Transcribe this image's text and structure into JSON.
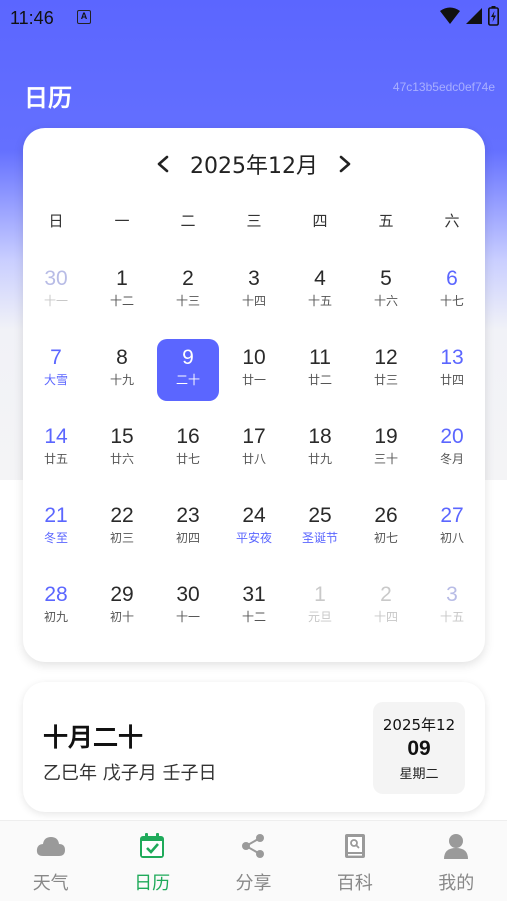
{
  "status_bar": {
    "time": "11:46",
    "notification_glyph": "A"
  },
  "header": {
    "title": "日历",
    "hash": "47c13b5edc0ef74e"
  },
  "calendar": {
    "month_title": "2025年12月",
    "prev_glyph": "‹",
    "next_glyph": "›",
    "weekdays": [
      "日",
      "一",
      "二",
      "三",
      "四",
      "五",
      "六"
    ],
    "weeks": [
      [
        {
          "num": "30",
          "lunar": "十一",
          "other": true
        },
        {
          "num": "1",
          "lunar": "十二"
        },
        {
          "num": "2",
          "lunar": "十三"
        },
        {
          "num": "3",
          "lunar": "十四"
        },
        {
          "num": "4",
          "lunar": "十五"
        },
        {
          "num": "5",
          "lunar": "十六"
        },
        {
          "num": "6",
          "lunar": "十七",
          "weekend": true
        }
      ],
      [
        {
          "num": "7",
          "lunar": "大雪",
          "weekend": true,
          "festival": true
        },
        {
          "num": "8",
          "lunar": "十九"
        },
        {
          "num": "9",
          "lunar": "二十",
          "selected": true
        },
        {
          "num": "10",
          "lunar": "廿一"
        },
        {
          "num": "11",
          "lunar": "廿二"
        },
        {
          "num": "12",
          "lunar": "廿三"
        },
        {
          "num": "13",
          "lunar": "廿四",
          "weekend": true
        }
      ],
      [
        {
          "num": "14",
          "lunar": "廿五",
          "weekend": true
        },
        {
          "num": "15",
          "lunar": "廿六"
        },
        {
          "num": "16",
          "lunar": "廿七"
        },
        {
          "num": "17",
          "lunar": "廿八"
        },
        {
          "num": "18",
          "lunar": "廿九"
        },
        {
          "num": "19",
          "lunar": "三十"
        },
        {
          "num": "20",
          "lunar": "冬月",
          "weekend": true
        }
      ],
      [
        {
          "num": "21",
          "lunar": "冬至",
          "weekend": true,
          "festival": true
        },
        {
          "num": "22",
          "lunar": "初三"
        },
        {
          "num": "23",
          "lunar": "初四"
        },
        {
          "num": "24",
          "lunar": "平安夜",
          "festival": true
        },
        {
          "num": "25",
          "lunar": "圣诞节",
          "festival": true
        },
        {
          "num": "26",
          "lunar": "初七"
        },
        {
          "num": "27",
          "lunar": "初八",
          "weekend": true
        }
      ],
      [
        {
          "num": "28",
          "lunar": "初九",
          "weekend": true
        },
        {
          "num": "29",
          "lunar": "初十"
        },
        {
          "num": "30",
          "lunar": "十一"
        },
        {
          "num": "31",
          "lunar": "十二"
        },
        {
          "num": "1",
          "lunar": "元旦",
          "other": true,
          "gray": true,
          "festival": true
        },
        {
          "num": "2",
          "lunar": "十四",
          "other": true,
          "gray": true
        },
        {
          "num": "3",
          "lunar": "十五",
          "other": true
        }
      ]
    ]
  },
  "info": {
    "lunar_date": "十月二十",
    "ganzhi": "乙巳年 戊子月 壬子日",
    "year_month": "2025年12",
    "day": "09",
    "weekday": "星期二"
  },
  "bottom_nav": {
    "items": [
      {
        "label": "天气",
        "icon": "cloud-icon"
      },
      {
        "label": "日历",
        "icon": "calendar-check-icon",
        "active": true
      },
      {
        "label": "分享",
        "icon": "share-icon"
      },
      {
        "label": "百科",
        "icon": "encyclopedia-icon"
      },
      {
        "label": "我的",
        "icon": "profile-icon"
      }
    ]
  },
  "colors": {
    "accent": "#5b66ff",
    "active_nav": "#1faa5a"
  }
}
